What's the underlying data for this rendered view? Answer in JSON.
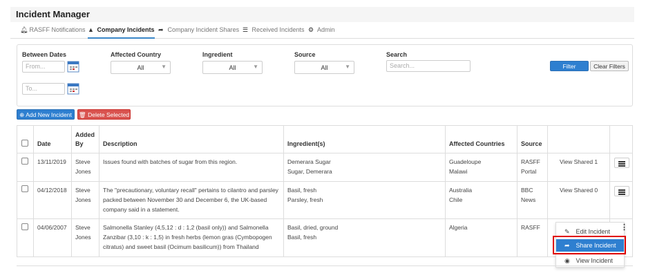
{
  "app": {
    "title": "Incident Manager"
  },
  "tabs": [
    {
      "label": "RASFF Notifications",
      "icon": "bell-icon"
    },
    {
      "label": "Company Incidents",
      "icon": "warning-icon"
    },
    {
      "label": "Company Incident Shares",
      "icon": "share-icon"
    },
    {
      "label": "Received Incidents",
      "icon": "list-icon"
    },
    {
      "label": "Admin",
      "icon": "gear-icon"
    }
  ],
  "active_tab": "Company Incidents",
  "filters": {
    "between_dates_label": "Between Dates",
    "from_placeholder": "From...",
    "to_placeholder": "To...",
    "affected_country_label": "Affected Country",
    "affected_country_value": "All",
    "ingredient_label": "Ingredient",
    "ingredient_value": "All",
    "source_label": "Source",
    "source_value": "All",
    "search_label": "Search",
    "search_placeholder": "Search...",
    "filter_button": "Filter",
    "clear_button": "Clear Filters"
  },
  "actions": {
    "add_new": "Add New Incident",
    "delete_selected": "Delete Selected"
  },
  "table": {
    "headers": {
      "date": "Date",
      "added_by_1": "Added",
      "added_by_2": "By",
      "description": "Description",
      "ingredients": "Ingredient(s)",
      "countries": "Affected Countries",
      "source": "Source"
    },
    "rows": [
      {
        "date": "13/11/2019",
        "added_by": [
          "Steve",
          "Jones"
        ],
        "description": [
          "Issues found with batches of sugar from this region."
        ],
        "ingredients": [
          "Demerara Sugar",
          "Sugar, Demerara"
        ],
        "countries": [
          "Guadeloupe",
          "Malawi"
        ],
        "source": [
          "RASFF",
          "Portal"
        ],
        "shared": "View Shared 1"
      },
      {
        "date": "04/12/2018",
        "added_by": [
          "Steve",
          "Jones"
        ],
        "description": [
          "The \"precautionary, voluntary recall\" pertains to cilantro and parsley",
          "packed between November 30 and December 6, the UK-based",
          "company said in a statement."
        ],
        "ingredients": [
          "Basil, fresh",
          "Parsley, fresh"
        ],
        "countries": [
          "Australia",
          "Chile"
        ],
        "source": [
          "BBC",
          "News"
        ],
        "shared": "View Shared 0"
      },
      {
        "date": "04/06/2007",
        "added_by": [
          "Steve",
          "Jones"
        ],
        "description": [
          "Salmonella Stanley (4,5,12 : d : 1,2 (basil only)) and Salmonella",
          "Zanzibar (3,10 : k : 1,5) in fresh herbs (lemon gras (Cymbopogen",
          "citratus) and sweet basil (Ocimum basilicum)) from Thailand"
        ],
        "ingredients": [
          "Basil, dried, ground",
          "Basil, fresh"
        ],
        "countries": [
          "Algeria"
        ],
        "source": [
          "RASFF"
        ],
        "shared": ""
      }
    ]
  },
  "context_menu": {
    "edit": "Edit Incident",
    "share": "Share Incident",
    "view": "View Incident"
  },
  "colors": {
    "accent": "#2e7fd0",
    "danger": "#d9534f",
    "highlight_border": "#e00000"
  }
}
